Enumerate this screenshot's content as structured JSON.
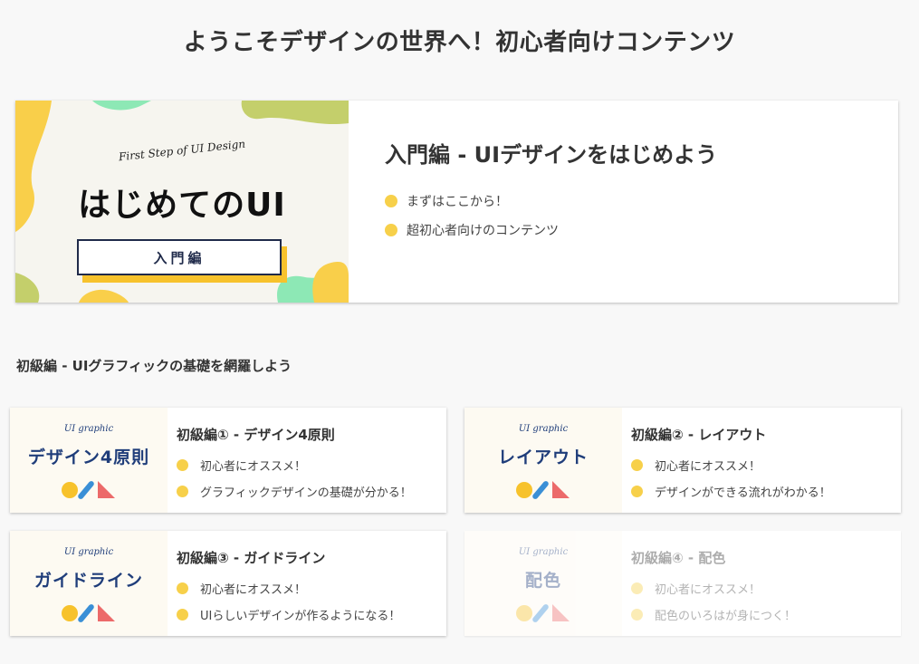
{
  "page": {
    "title": "ようこそデザインの世界へ！初心者向けコンテンツ"
  },
  "hero": {
    "thumb_script": "First Step of UI Design",
    "thumb_title": "はじめてのUI",
    "thumb_badge": "入門編",
    "heading": "入門編 - UIデザインをはじめよう",
    "bullets": [
      "まずはここから！",
      "超初心者向けのコンテンツ"
    ]
  },
  "section": {
    "heading": "初級編 - UIグラフィックの基礎を網羅しよう"
  },
  "cards": [
    {
      "thumb_script": "UI graphic",
      "thumb_title": "デザイン4原則",
      "title": "初級編① - デザイン4原則",
      "bullets": [
        "初心者にオススメ！",
        "グラフィックデザインの基礎が分かる！"
      ]
    },
    {
      "thumb_script": "UI graphic",
      "thumb_title": "レイアウト",
      "title": "初級編② - レイアウト",
      "bullets": [
        "初心者にオススメ！",
        "デザインができる流れがわかる！"
      ]
    },
    {
      "thumb_script": "UI graphic",
      "thumb_title": "ガイドライン",
      "title": "初級編③ - ガイドライン",
      "bullets": [
        "初心者にオススメ！",
        "UIらしいデザインが作るようになる！"
      ]
    },
    {
      "thumb_script": "UI graphic",
      "thumb_title": "配色",
      "title": "初級編④ - 配色",
      "bullets": [
        "初心者にオススメ！",
        "配色のいろはが身につく！"
      ]
    }
  ],
  "colors": {
    "accent_yellow": "#f7d04a",
    "thumb_navy": "#1f3d7a",
    "icon_blue": "#3a8fd6",
    "icon_red": "#ec6a6a",
    "blob_green": "#8de8b5",
    "blob_olive": "#c4cf6b"
  }
}
